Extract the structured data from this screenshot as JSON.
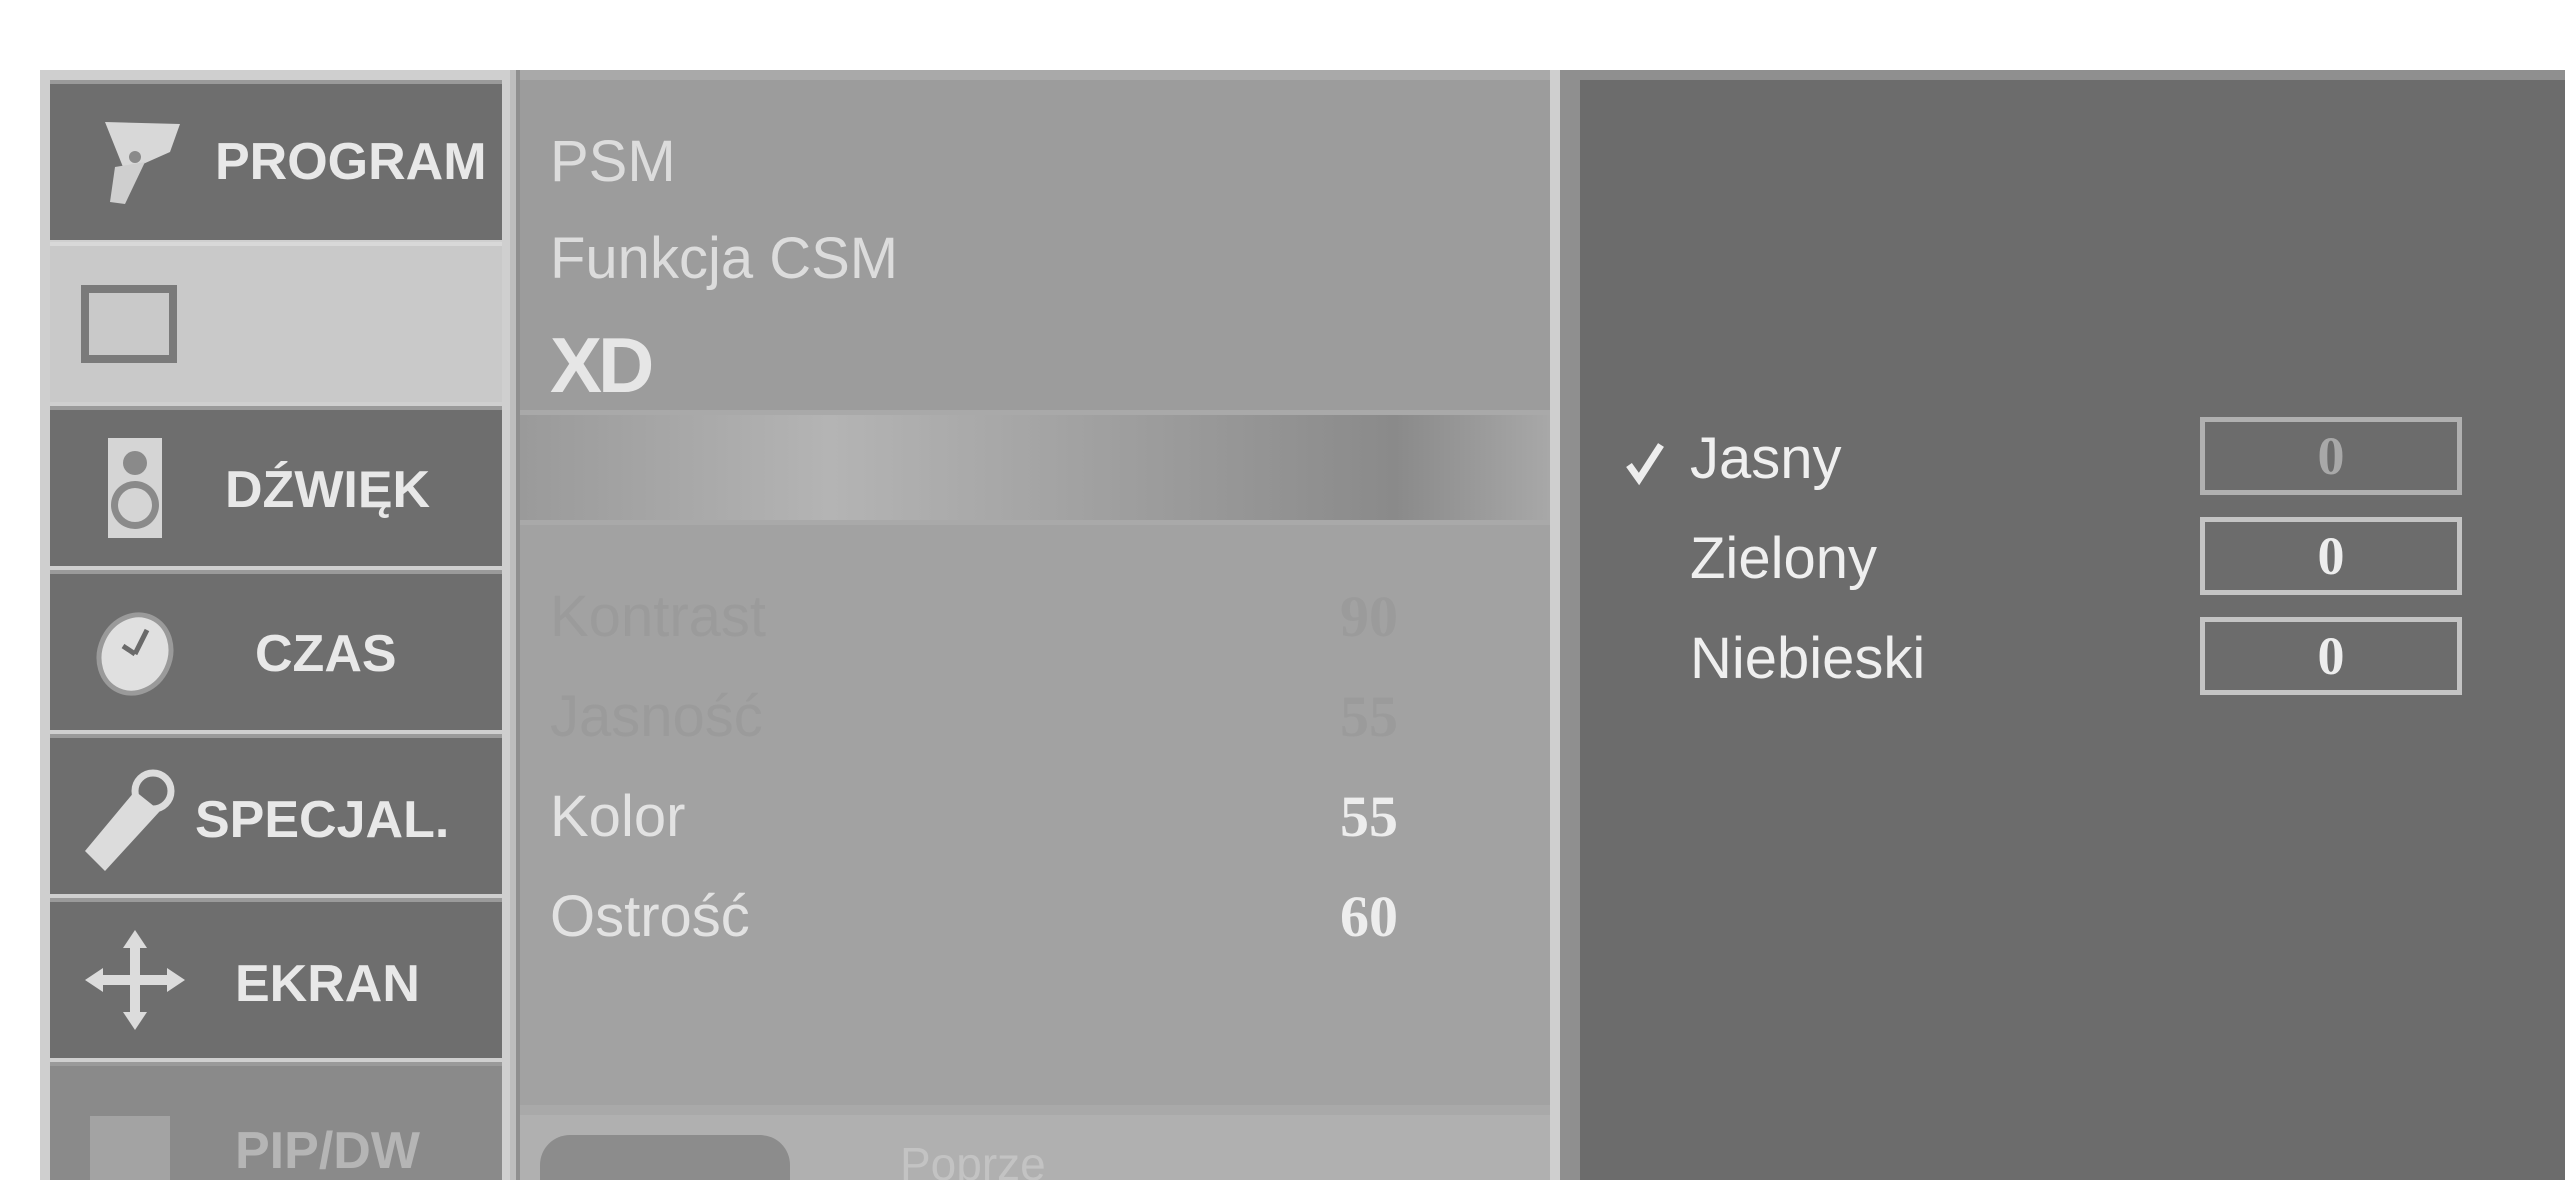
{
  "categories": [
    {
      "label": "PROGRAM",
      "icon": "satellite-dish-icon"
    },
    {
      "label": "",
      "icon": "picture-screen-icon"
    },
    {
      "label": "DŹWIĘK",
      "icon": "speaker-icon"
    },
    {
      "label": "CZAS",
      "icon": "clock-icon"
    },
    {
      "label": "SPECJAL.",
      "icon": "key-tag-icon"
    },
    {
      "label": "EKRAN",
      "icon": "move-arrows-icon"
    },
    {
      "label": "PIP/DW",
      "icon": "pip-icon"
    }
  ],
  "picture_menu": {
    "items": [
      "PSM",
      "Funkcja CSM"
    ],
    "xd_logo": "XD",
    "adjustments": [
      {
        "label": "Kontrast",
        "value": "90"
      },
      {
        "label": "Jasność",
        "value": "55"
      },
      {
        "label": "Kolor",
        "value": "55"
      },
      {
        "label": "Ostrość",
        "value": "60"
      }
    ],
    "nav_hint": "Poprze"
  },
  "csm_panel": {
    "options": [
      {
        "label": "Jasny",
        "value": "0",
        "checked": true
      },
      {
        "label": "Zielony",
        "value": "0",
        "checked": false
      },
      {
        "label": "Niebieski",
        "value": "0",
        "checked": false
      }
    ]
  },
  "colors": {
    "background": "#8f8f8f",
    "category_normal": "#6e6e6e",
    "category_selected": "#c9c9c9",
    "text_light": "#e8e8e8"
  }
}
